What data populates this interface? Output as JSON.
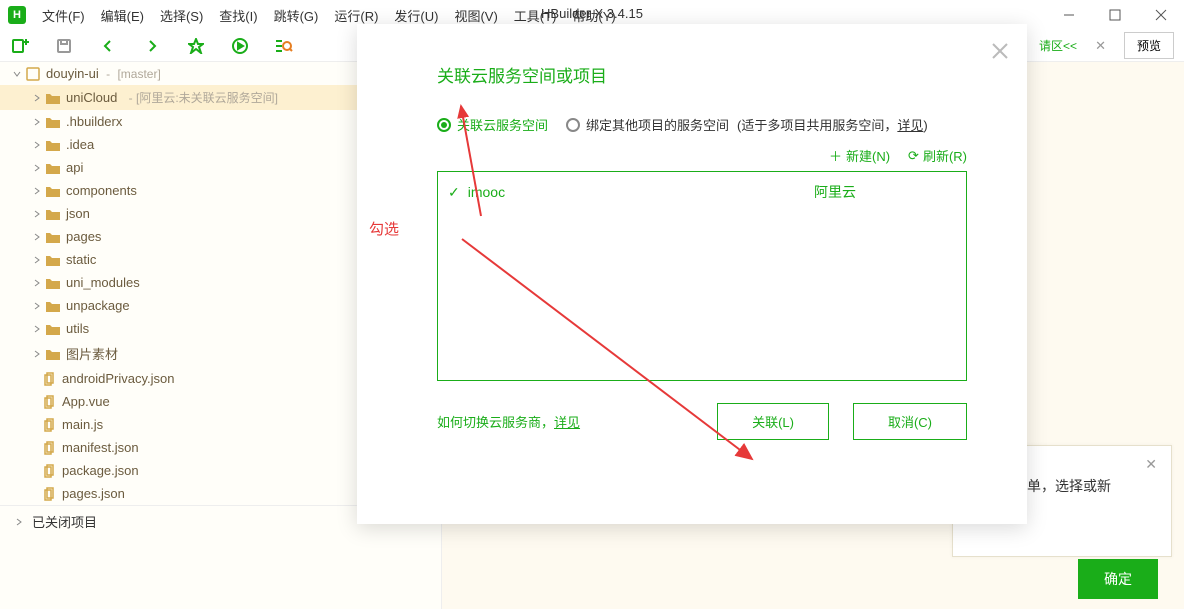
{
  "app": {
    "title": "HBuilder X 3.4.15"
  },
  "menu": {
    "file": "文件(F)",
    "edit": "编辑(E)",
    "select": "选择(S)",
    "find": "查找(I)",
    "goto": "跳转(G)",
    "run": "运行(R)",
    "release": "发行(U)",
    "view": "视图(V)",
    "tools": "工具(T)",
    "help": "帮助(Y)"
  },
  "toolbar": {
    "inputArea": "请区<<",
    "preview": "预览"
  },
  "tree": {
    "project": {
      "name": "douyin-ui",
      "branch": "[master]"
    },
    "unicloud": {
      "name": "uniCloud",
      "suffix": "- [阿里云:未关联云服务空间]"
    },
    "folders": {
      "hbuilderx": ".hbuilderx",
      "idea": ".idea",
      "api": "api",
      "components": "components",
      "json": "json",
      "pages": "pages",
      "static": "static",
      "uni_modules": "uni_modules",
      "unpackage": "unpackage",
      "utils": "utils",
      "images": "图片素材"
    },
    "files": {
      "androidPrivacy": "androidPrivacy.json",
      "appVue": "App.vue",
      "mainJs": "main.js",
      "manifest": "manifest.json",
      "package": "package.json",
      "pagesJson": "pages.json"
    },
    "closedProjects": "已关闭项目"
  },
  "hint": {
    "text": "菜单，选择或新",
    "confirm": "确定"
  },
  "dialog": {
    "title": "关联云服务空间或项目",
    "radio1": "关联云服务空间",
    "radio2": "绑定其他项目的服务空间",
    "radioHint": "(适于多项目共用服务空间，",
    "radioHintLink": "详见",
    "radioHintEnd": ")",
    "newBtn": "新建(N)",
    "refreshBtn": "刷新(R)",
    "item": {
      "name": "imooc",
      "provider": "阿里云"
    },
    "footerText": "如何切换云服务商，",
    "footerLink": "详见",
    "link": "关联(L)",
    "cancel": "取消(C)",
    "annotation": "勾选"
  },
  "watermark": ""
}
